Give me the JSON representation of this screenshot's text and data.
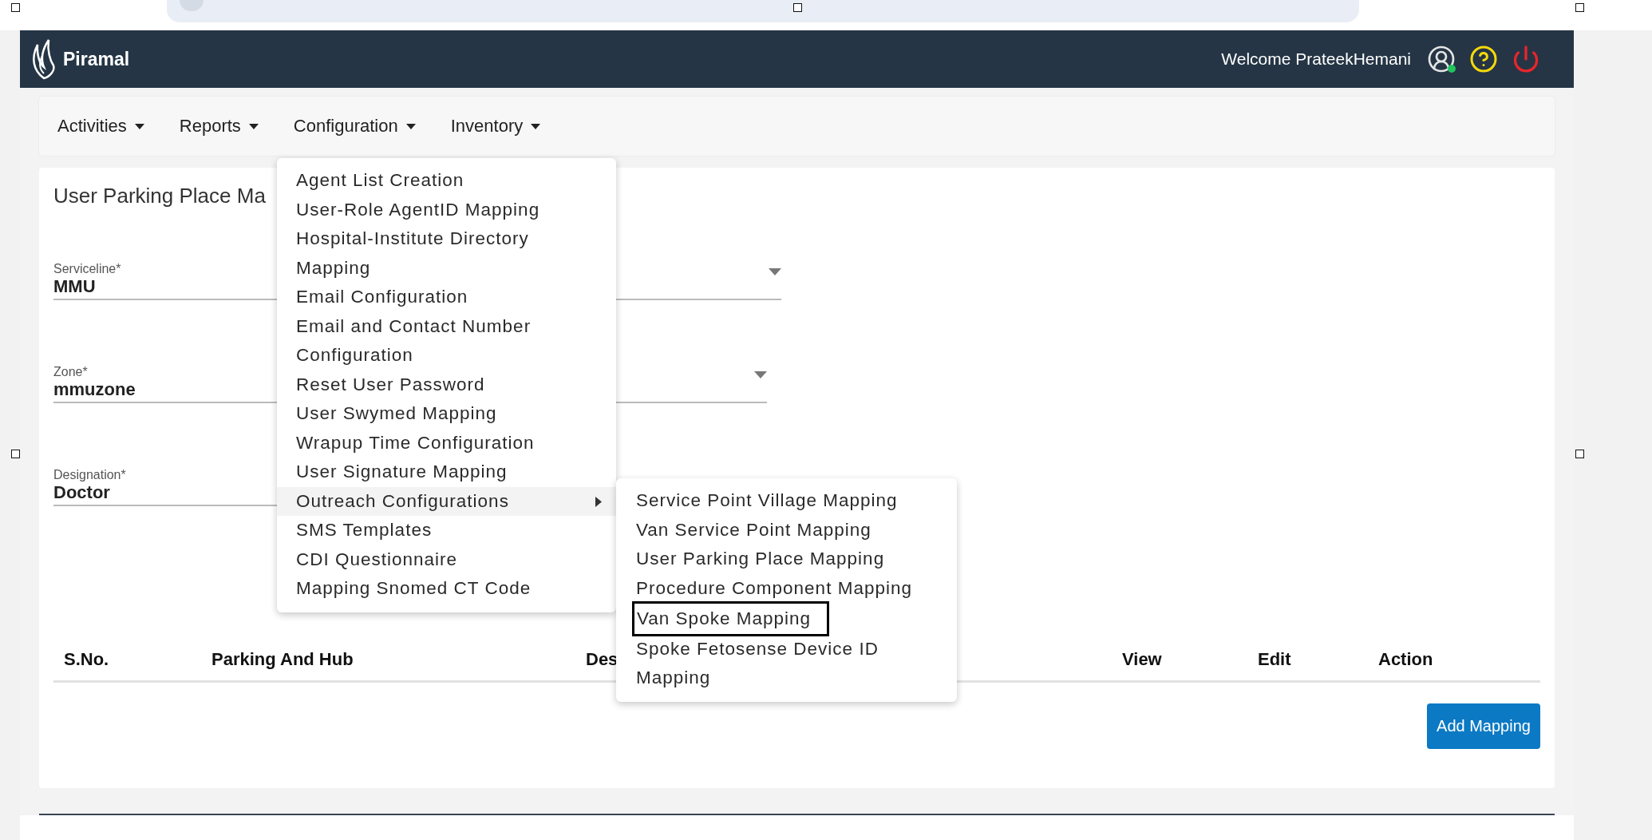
{
  "header": {
    "brand": "Piramal",
    "welcome": "Welcome PrateekHemani"
  },
  "nav": [
    "Activities",
    "Reports",
    "Configuration",
    "Inventory"
  ],
  "page_title": "User Parking Place Ma",
  "fields": [
    {
      "label": "Serviceline*",
      "value": "MMU",
      "dropdown_icon": true
    },
    {
      "label": "Zone*",
      "value": "mmuzone",
      "dropdown_icon": true
    },
    {
      "label": "Designation*",
      "value": "Doctor",
      "dropdown_icon": false
    }
  ],
  "table": {
    "columns": [
      "S.No.",
      "Parking And Hub",
      "Des",
      "View",
      "Edit",
      "Action"
    ]
  },
  "add_button": "Add Mapping",
  "menu": {
    "items": [
      {
        "label": "Agent List Creation",
        "selected": false,
        "has_submenu": false
      },
      {
        "label": "User-Role AgentID Mapping",
        "selected": false,
        "has_submenu": false
      },
      {
        "label": "Hospital-Institute Directory Mapping",
        "selected": false,
        "has_submenu": false
      },
      {
        "label": "Email Configuration",
        "selected": false,
        "has_submenu": false
      },
      {
        "label": "Email and Contact Number Configuration",
        "selected": false,
        "has_submenu": false
      },
      {
        "label": "Reset User Password",
        "selected": false,
        "has_submenu": false
      },
      {
        "label": "User Swymed Mapping",
        "selected": false,
        "has_submenu": false
      },
      {
        "label": "Wrapup Time Configuration",
        "selected": false,
        "has_submenu": false
      },
      {
        "label": "User Signature Mapping",
        "selected": false,
        "has_submenu": false
      },
      {
        "label": "Outreach Configurations",
        "selected": true,
        "has_submenu": true
      },
      {
        "label": "SMS Templates",
        "selected": false,
        "has_submenu": false
      },
      {
        "label": "CDI Questionnaire",
        "selected": false,
        "has_submenu": false
      },
      {
        "label": "Mapping Snomed CT Code",
        "selected": false,
        "has_submenu": false
      }
    ]
  },
  "submenu": {
    "items": [
      {
        "label": "Service Point Village Mapping",
        "selected": false
      },
      {
        "label": "Van Service Point Mapping",
        "selected": false
      },
      {
        "label": "User Parking Place Mapping",
        "selected": false
      },
      {
        "label": "Procedure Component Mapping",
        "selected": false
      },
      {
        "label": "Van Spoke Mapping",
        "selected": true
      },
      {
        "label": "Spoke Fetosense Device ID Mapping",
        "selected": false
      }
    ]
  }
}
